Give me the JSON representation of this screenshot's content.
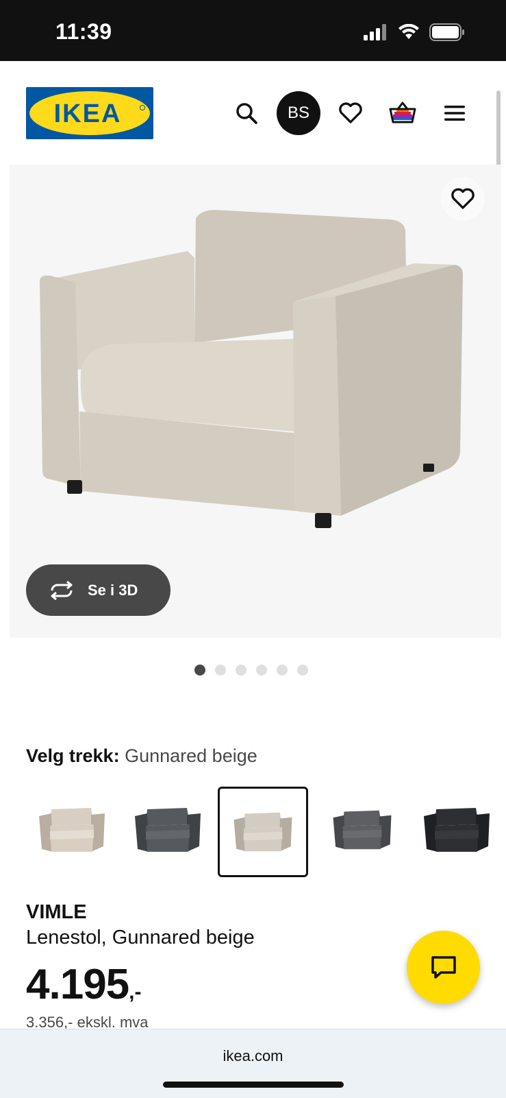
{
  "status_bar": {
    "time": "11:39"
  },
  "header": {
    "logo_text": "IKEA",
    "avatar_initials": "BS",
    "colors": {
      "logo_blue": "#0058a3",
      "logo_yellow": "#ffda1a"
    }
  },
  "hero": {
    "view_3d_label": "Se i 3D",
    "image_count": 6,
    "active_image": 1
  },
  "cover": {
    "label": "Velg trekk:",
    "selected": "Gunnared beige",
    "options": [
      {
        "color": "#d8cfc2",
        "shade": "#b9ae9f"
      },
      {
        "color": "#56595e",
        "shade": "#3f4246"
      },
      {
        "color": "#d3ccc2",
        "shade": "#b5ada2",
        "selected": true
      },
      {
        "color": "#5e5f63",
        "shade": "#46474b"
      },
      {
        "color": "#2e2f32",
        "shade": "#1f2022"
      }
    ]
  },
  "product": {
    "name": "VIMLE",
    "description": "Lenestol, Gunnared beige",
    "price": "4.195",
    "price_suffix": ",-",
    "price_ex_vat": "3.356,- ekskl. mva"
  },
  "browser": {
    "url": "ikea.com"
  },
  "icons": [
    "search-icon",
    "heart-icon",
    "basket-icon",
    "menu-icon",
    "rotate-3d-icon",
    "chat-icon"
  ]
}
